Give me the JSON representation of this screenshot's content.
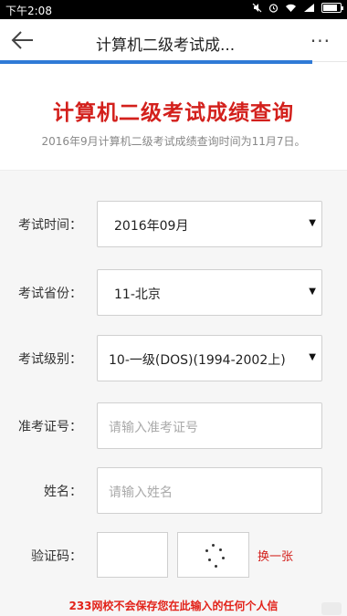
{
  "status_bar": {
    "time": "下午2:08",
    "icons": [
      "mute-icon",
      "alarm-icon",
      "wifi-icon",
      "signal-icon",
      "battery-icon"
    ],
    "battery_level": 0.85
  },
  "app_bar": {
    "title": "计算机二级考试成...",
    "back_icon": "arrow-left-icon",
    "more_icon": "more-dots-icon",
    "more_label": "···",
    "load_progress": 0.9,
    "accent": "#2f7ad6"
  },
  "header": {
    "title": "计算机二级考试成绩查询",
    "notice": "2016年9月计算机二级考试成绩查询时间为11月7日。",
    "title_color": "#d3201c"
  },
  "form": {
    "exam_time": {
      "label": "考试时间：",
      "value": "2016年09月"
    },
    "province": {
      "label": "考试省份：",
      "value": "11-北京"
    },
    "level": {
      "label": "考试级别：",
      "value": "10-一级(DOS)(1994-2002上)"
    },
    "ticket": {
      "label": "准考证号：",
      "placeholder": "请输入准考证号"
    },
    "name": {
      "label": "姓名：",
      "placeholder": "请输入姓名"
    },
    "captcha": {
      "label": "验证码：",
      "value": "",
      "refresh_label": "换一张"
    },
    "dropdown_arrow": "▼"
  },
  "footer": {
    "note": "233网校不会保存您在此输入的任何个人信"
  }
}
